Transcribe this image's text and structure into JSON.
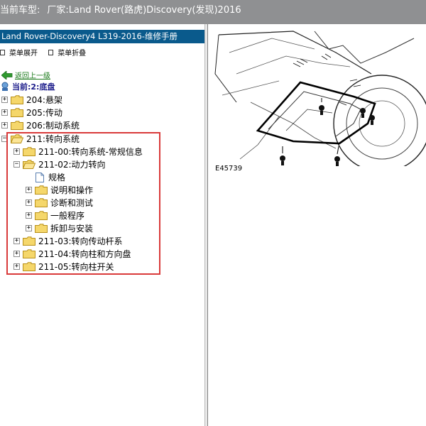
{
  "title_bar": {
    "label": "当前车型:",
    "vehicle": "厂家:Land Rover(路虎)Discovery(发现)2016"
  },
  "left_panel": {
    "manual_title": "Land Rover-Discovery4 L319-2016-维修手册",
    "menu": {
      "expand_label": "菜单展开",
      "collapse_label": "菜单折叠"
    },
    "back_link": "返回上一级",
    "current_location": "当前:2:底盘",
    "tree": [
      {
        "label": "204:悬架",
        "expanded": false
      },
      {
        "label": "205:传动",
        "expanded": false
      },
      {
        "label": "206:制动系统",
        "expanded": false
      },
      {
        "label": "211:转向系统",
        "expanded": true
      },
      {
        "label": "211-00:转向系统-常规信息",
        "expanded": false
      },
      {
        "label": "211-02:动力转向",
        "expanded": true
      },
      {
        "label": "规格",
        "type": "document"
      },
      {
        "label": "说明和操作",
        "expanded": false
      },
      {
        "label": "诊断和测试",
        "expanded": false
      },
      {
        "label": "一般程序",
        "expanded": false
      },
      {
        "label": "拆卸与安装",
        "expanded": false
      },
      {
        "label": "211-03:转向传动杆系",
        "expanded": false
      },
      {
        "label": "211-04:转向柱和方向盘",
        "expanded": false
      },
      {
        "label": "211-05:转向柱开关",
        "expanded": false
      }
    ]
  },
  "figure": {
    "caption": "E45739"
  },
  "colors": {
    "title_bar_bg": "#8f9092",
    "manual_header_bg": "#0a5a8c",
    "highlight_border": "#d93a3a",
    "back_link": "#1a7a1a"
  },
  "icons": {
    "back": "green-left-arrow-icon",
    "current": "location-icon",
    "folder": "folder-icon",
    "document": "document-icon"
  }
}
